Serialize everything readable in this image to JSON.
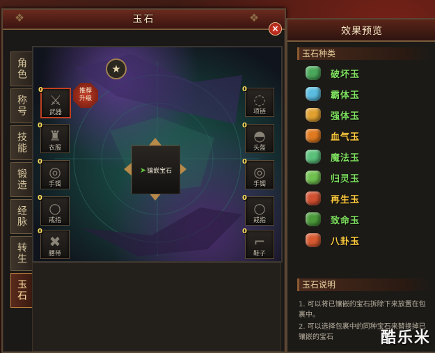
{
  "main_window": {
    "title": "玉石",
    "close_symbol": "×"
  },
  "tabs": [
    "角色",
    "称号",
    "技能",
    "锻造",
    "经脉",
    "转生",
    "玉石"
  ],
  "active_tab_index": 6,
  "board": {
    "star_symbol": "★",
    "recommend_line1": "推荐",
    "recommend_line2": "升级",
    "center_label": "镶嵌宝石",
    "left_slots": [
      {
        "count": "0",
        "label": "武器",
        "icon": "sword-icon"
      },
      {
        "count": "0",
        "label": "衣服",
        "icon": "armor-icon"
      },
      {
        "count": "0",
        "label": "手镯",
        "icon": "bracelet-icon"
      },
      {
        "count": "0",
        "label": "戒指",
        "icon": "ring-icon"
      },
      {
        "count": "0",
        "label": "腰带",
        "icon": "belt-icon"
      }
    ],
    "right_slots": [
      {
        "count": "0",
        "label": "项链",
        "icon": "necklace-icon"
      },
      {
        "count": "0",
        "label": "头盔",
        "icon": "helmet-icon"
      },
      {
        "count": "0",
        "label": "手镯",
        "icon": "bracelet-icon"
      },
      {
        "count": "0",
        "label": "戒指",
        "icon": "ring-icon"
      },
      {
        "count": "0",
        "label": "鞋子",
        "icon": "boots-icon"
      }
    ]
  },
  "side_window": {
    "title": "效果预览",
    "gem_section_title": "玉石种类",
    "gems": [
      {
        "name": "破坏玉",
        "color": "#7fe060",
        "icon_color": "#4aa85a"
      },
      {
        "name": "霸体玉",
        "color": "#7fe060",
        "icon_color": "#5abce0"
      },
      {
        "name": "强体玉",
        "color": "#7fe060",
        "icon_color": "#e0a030"
      },
      {
        "name": "血气玉",
        "color": "#ffcc40",
        "icon_color": "#e07a20"
      },
      {
        "name": "魔法玉",
        "color": "#7fe060",
        "icon_color": "#5ac07a"
      },
      {
        "name": "归灵玉",
        "color": "#7fe060",
        "icon_color": "#70c050"
      },
      {
        "name": "再生玉",
        "color": "#ffcc40",
        "icon_color": "#d05030"
      },
      {
        "name": "致命玉",
        "color": "#7fe060",
        "icon_color": "#4a9a3a"
      },
      {
        "name": "八卦玉",
        "color": "#ffcc40",
        "icon_color": "#d85a30"
      }
    ],
    "desc_section_title": "玉石说明",
    "desc_lines": [
      "1. 可以将已镶嵌的宝石拆除下来放置在包裹中。",
      "2. 可以选择包裹中的同种宝石来替换掉已镶嵌的宝石"
    ]
  },
  "watermark": "酷乐米"
}
